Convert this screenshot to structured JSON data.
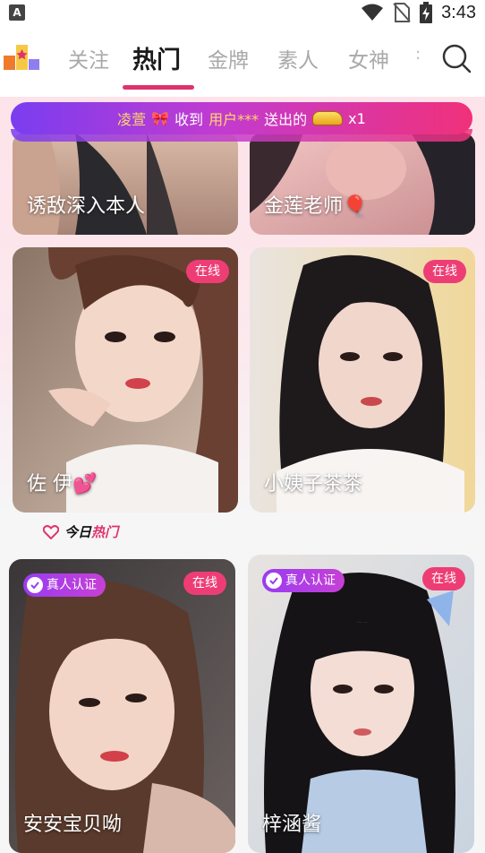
{
  "status_bar": {
    "notification_glyph": "A",
    "time": "3:43",
    "icons": [
      "wifi-icon",
      "no-sim-icon",
      "battery-charging-icon"
    ]
  },
  "nav": {
    "tabs": [
      {
        "label": "关注",
        "active": false
      },
      {
        "label": "热门",
        "active": true
      },
      {
        "label": "金牌",
        "active": false
      },
      {
        "label": "素人",
        "active": false
      },
      {
        "label": "女神",
        "active": false
      }
    ],
    "more_hint": ":",
    "search_icon": "search-icon",
    "logo_icon": "app-logo-icon"
  },
  "gift_banner": {
    "sender_user": "凌萱",
    "verb": "收到",
    "receiver": "用户***",
    "action": "送出的",
    "gift_icon": "sports-car-icon",
    "count": "x1"
  },
  "cards_top": [
    {
      "name": "诱敌深入本人"
    },
    {
      "name": "金莲老师🎈"
    }
  ],
  "cards_hot": [
    {
      "name": "佐 伊💕",
      "online": "在线"
    },
    {
      "name": "小姨子茶茶",
      "online": "在线"
    }
  ],
  "today_hot": {
    "prefix": "今日",
    "hot": "热门",
    "icon": "heart-icon"
  },
  "cards_main": [
    {
      "name": "安安宝贝呦",
      "online": "在线",
      "verified": "真人认证"
    },
    {
      "name": "梓涵酱",
      "online": "在线",
      "verified": "真人认证"
    }
  ],
  "colors": {
    "accent": "#e0336c",
    "online_badge": "#ee3d75",
    "verify_badge": "#9a3cf1",
    "banner_highlight": "#ffd76a"
  }
}
